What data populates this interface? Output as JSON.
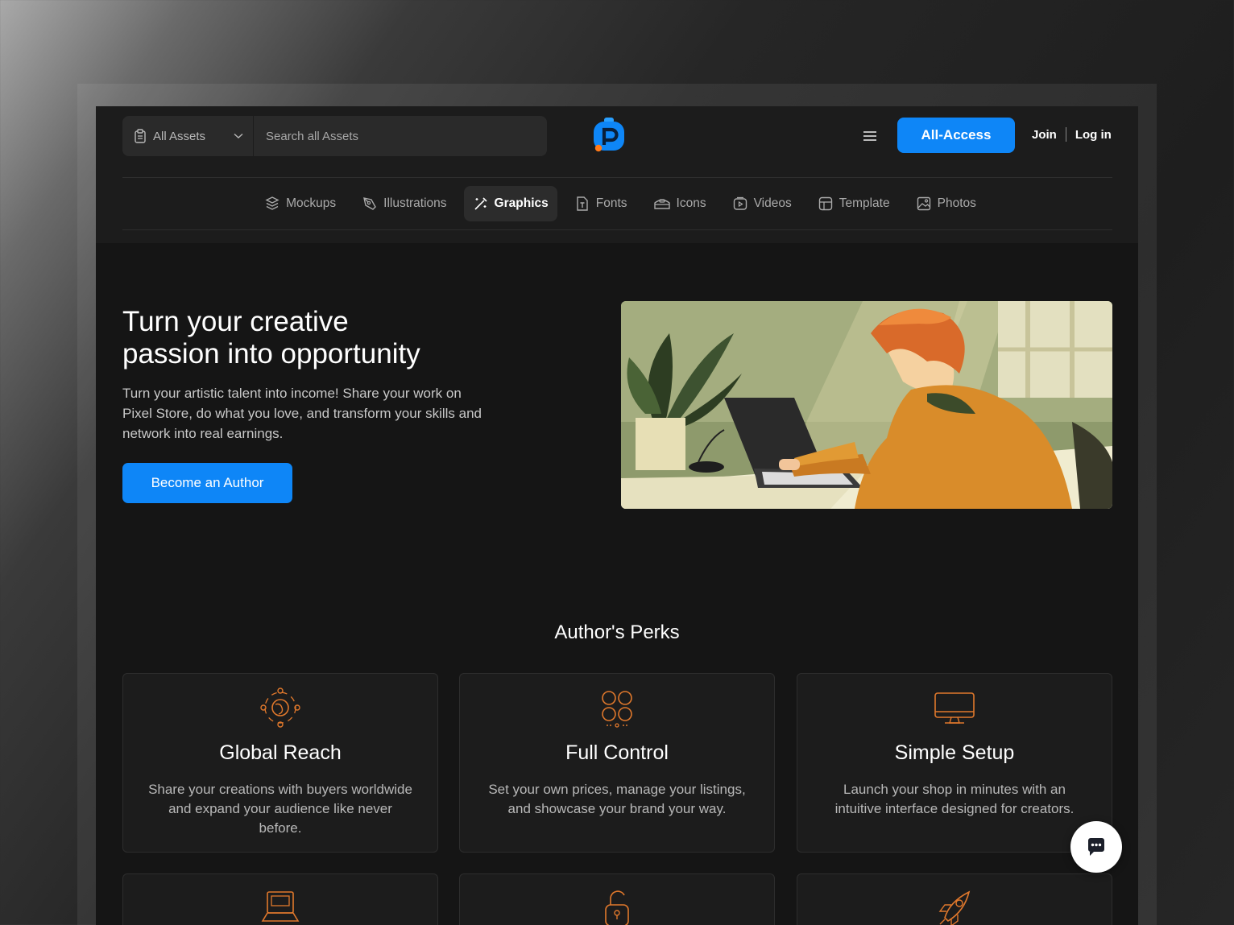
{
  "search": {
    "scope_label": "All Assets",
    "placeholder": "Search all Assets"
  },
  "header": {
    "all_access_label": "All-Access",
    "join_label": "Join",
    "login_label": "Log in"
  },
  "categories": [
    {
      "label": "Mockups",
      "icon": "mockups-icon",
      "active": false
    },
    {
      "label": "Illustrations",
      "icon": "illustrations-icon",
      "active": false
    },
    {
      "label": "Graphics",
      "icon": "graphics-icon",
      "active": true
    },
    {
      "label": "Fonts",
      "icon": "fonts-icon",
      "active": false
    },
    {
      "label": "Icons",
      "icon": "icons-icon",
      "active": false
    },
    {
      "label": "Videos",
      "icon": "videos-icon",
      "active": false
    },
    {
      "label": "Template",
      "icon": "template-icon",
      "active": false
    },
    {
      "label": "Photos",
      "icon": "photos-icon",
      "active": false
    }
  ],
  "hero": {
    "title_line1": "Turn your creative",
    "title_line2": "passion into opportunity",
    "description": "Turn your artistic talent into income! Share your work on Pixel Store, do what you love, and transform your skills and network into real earnings.",
    "cta_label": "Become an Author"
  },
  "perks": {
    "title": "Author's Perks",
    "items": [
      {
        "title": "Global Reach",
        "text": "Share your creations with buyers worldwide and expand your audience like never before.",
        "icon": "globe-network-icon"
      },
      {
        "title": "Full Control",
        "text": "Set your own prices, manage your listings, and showcase your brand your way.",
        "icon": "control-grid-icon"
      },
      {
        "title": "Simple Setup",
        "text": "Launch your shop in minutes with an intuitive interface designed for creators.",
        "icon": "monitor-icon"
      },
      {
        "title": "",
        "text": "",
        "icon": "laptop-icon"
      },
      {
        "title": "",
        "text": "",
        "icon": "unlock-icon"
      },
      {
        "title": "",
        "text": "",
        "icon": "rocket-icon"
      }
    ]
  },
  "colors": {
    "accent": "#0e86f7",
    "perk_icon": "#e0782c",
    "background": "#151515"
  }
}
